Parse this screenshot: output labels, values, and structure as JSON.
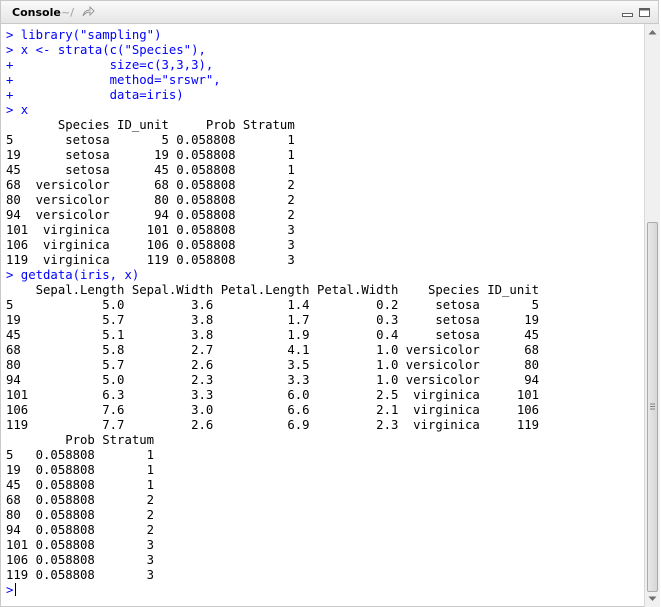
{
  "header": {
    "title": "Console",
    "path": "~/"
  },
  "console": {
    "prompt": ">",
    "lines": [
      {
        "text": "> library(\"sampling\")",
        "kind": "input"
      },
      {
        "text": "> x <- strata(c(\"Species\"),",
        "kind": "input"
      },
      {
        "text": "+             size=c(3,3,3),",
        "kind": "input"
      },
      {
        "text": "+             method=\"srswr\",",
        "kind": "input"
      },
      {
        "text": "+             data=iris)",
        "kind": "input"
      },
      {
        "text": "> x",
        "kind": "input"
      },
      {
        "text": "       Species ID_unit     Prob Stratum",
        "kind": "output"
      },
      {
        "text": "5       setosa       5 0.058808       1",
        "kind": "output"
      },
      {
        "text": "19      setosa      19 0.058808       1",
        "kind": "output"
      },
      {
        "text": "45      setosa      45 0.058808       1",
        "kind": "output"
      },
      {
        "text": "68  versicolor      68 0.058808       2",
        "kind": "output"
      },
      {
        "text": "80  versicolor      80 0.058808       2",
        "kind": "output"
      },
      {
        "text": "94  versicolor      94 0.058808       2",
        "kind": "output"
      },
      {
        "text": "101  virginica     101 0.058808       3",
        "kind": "output"
      },
      {
        "text": "106  virginica     106 0.058808       3",
        "kind": "output"
      },
      {
        "text": "119  virginica     119 0.058808       3",
        "kind": "output"
      },
      {
        "text": "> getdata(iris, x)",
        "kind": "input"
      },
      {
        "text": "    Sepal.Length Sepal.Width Petal.Length Petal.Width    Species ID_unit",
        "kind": "output"
      },
      {
        "text": "5            5.0         3.6          1.4         0.2     setosa       5",
        "kind": "output"
      },
      {
        "text": "19           5.7         3.8          1.7         0.3     setosa      19",
        "kind": "output"
      },
      {
        "text": "45           5.1         3.8          1.9         0.4     setosa      45",
        "kind": "output"
      },
      {
        "text": "68           5.8         2.7          4.1         1.0 versicolor      68",
        "kind": "output"
      },
      {
        "text": "80           5.7         2.6          3.5         1.0 versicolor      80",
        "kind": "output"
      },
      {
        "text": "94           5.0         2.3          3.3         1.0 versicolor      94",
        "kind": "output"
      },
      {
        "text": "101          6.3         3.3          6.0         2.5  virginica     101",
        "kind": "output"
      },
      {
        "text": "106          7.6         3.0          6.6         2.1  virginica     106",
        "kind": "output"
      },
      {
        "text": "119          7.7         2.6          6.9         2.3  virginica     119",
        "kind": "output"
      },
      {
        "text": "        Prob Stratum",
        "kind": "output"
      },
      {
        "text": "5   0.058808       1",
        "kind": "output"
      },
      {
        "text": "19  0.058808       1",
        "kind": "output"
      },
      {
        "text": "45  0.058808       1",
        "kind": "output"
      },
      {
        "text": "68  0.058808       2",
        "kind": "output"
      },
      {
        "text": "80  0.058808       2",
        "kind": "output"
      },
      {
        "text": "94  0.058808       2",
        "kind": "output"
      },
      {
        "text": "101 0.058808       3",
        "kind": "output"
      },
      {
        "text": "106 0.058808       3",
        "kind": "output"
      },
      {
        "text": "119 0.058808       3",
        "kind": "output"
      }
    ]
  },
  "icons": {
    "navigate": "arrow-link-icon",
    "minimize": "minimize-icon",
    "maximize": "maximize-icon"
  },
  "colors": {
    "input_text": "#0000ff",
    "output_text": "#000000",
    "path_text": "#a0a0a0"
  }
}
